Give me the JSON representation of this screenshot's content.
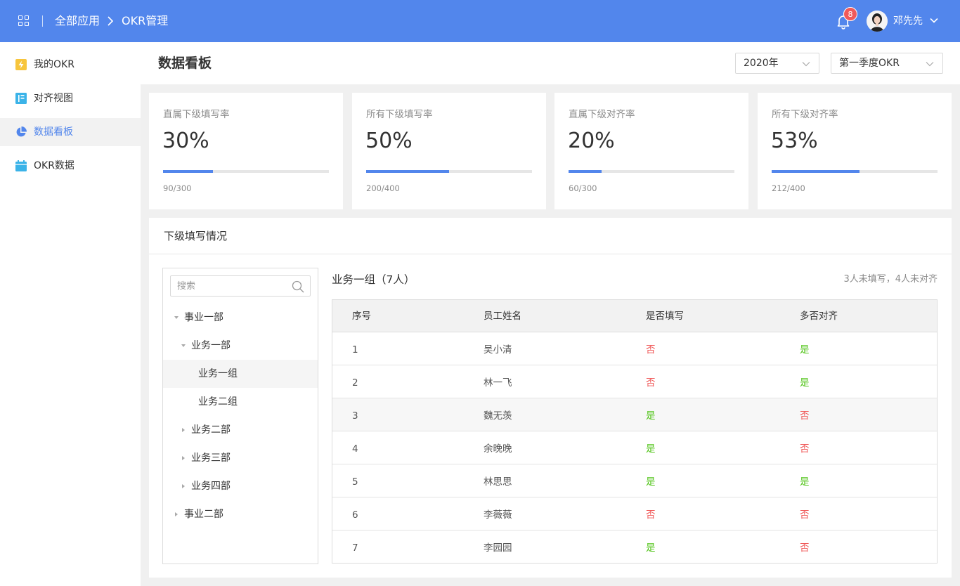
{
  "header": {
    "breadcrumb_all": "全部应用",
    "breadcrumb_sep": ">",
    "breadcrumb_current": "OKR管理",
    "notification_count": "8",
    "user_name": "邓先先"
  },
  "sidebar": {
    "items": [
      {
        "label": "我的OKR",
        "icon": "lightning-icon"
      },
      {
        "label": "对齐视图",
        "icon": "layout-icon"
      },
      {
        "label": "数据看板",
        "icon": "pie-chart-icon",
        "active": true
      },
      {
        "label": "OKR数据",
        "icon": "calendar-icon"
      }
    ]
  },
  "page": {
    "title": "数据看板",
    "year_select": "2020年",
    "quarter_select": "第一季度OKR"
  },
  "stats": [
    {
      "title": "直属下级填写率",
      "value": "30%",
      "fraction": 0.3,
      "detail": "90/300"
    },
    {
      "title": "所有下级填写率",
      "value": "50%",
      "fraction": 0.5,
      "detail": "200/400"
    },
    {
      "title": "直属下级对齐率",
      "value": "20%",
      "fraction": 0.2,
      "detail": "60/300"
    },
    {
      "title": "所有下级对齐率",
      "value": "53%",
      "fraction": 0.53,
      "detail": "212/400"
    }
  ],
  "subordinates": {
    "title": "下级填写情况",
    "search_placeholder": "搜索",
    "tree": [
      {
        "label": "事业一部",
        "expanded": true
      },
      {
        "label": "业务一部",
        "expanded": true
      },
      {
        "label": "业务一组",
        "selected": true
      },
      {
        "label": "业务二组"
      },
      {
        "label": "业务二部",
        "expanded": false
      },
      {
        "label": "业务三部",
        "expanded": false
      },
      {
        "label": "业务四部",
        "expanded": false
      },
      {
        "label": "事业二部",
        "expanded": false
      }
    ],
    "group_title": "业务一组（7人）",
    "group_summary": "3人未填写，4人未对齐",
    "table": {
      "headers": [
        "序号",
        "员工姓名",
        "是否填写",
        "多否对齐"
      ],
      "rows": [
        {
          "no": "1",
          "name": "吴小清",
          "filled": "否",
          "aligned": "是"
        },
        {
          "no": "2",
          "name": "林一飞",
          "filled": "否",
          "aligned": "是"
        },
        {
          "no": "3",
          "name": "魏无羡",
          "filled": "是",
          "aligned": "否"
        },
        {
          "no": "4",
          "name": "余晚晚",
          "filled": "是",
          "aligned": "否"
        },
        {
          "no": "5",
          "name": "林思思",
          "filled": "是",
          "aligned": "是"
        },
        {
          "no": "6",
          "name": "李薇薇",
          "filled": "否",
          "aligned": "否"
        },
        {
          "no": "7",
          "name": "李园园",
          "filled": "是",
          "aligned": "否"
        }
      ]
    }
  },
  "colors": {
    "brand": "#5286ec",
    "yes": "#52c41a",
    "no": "#f05a5a"
  }
}
